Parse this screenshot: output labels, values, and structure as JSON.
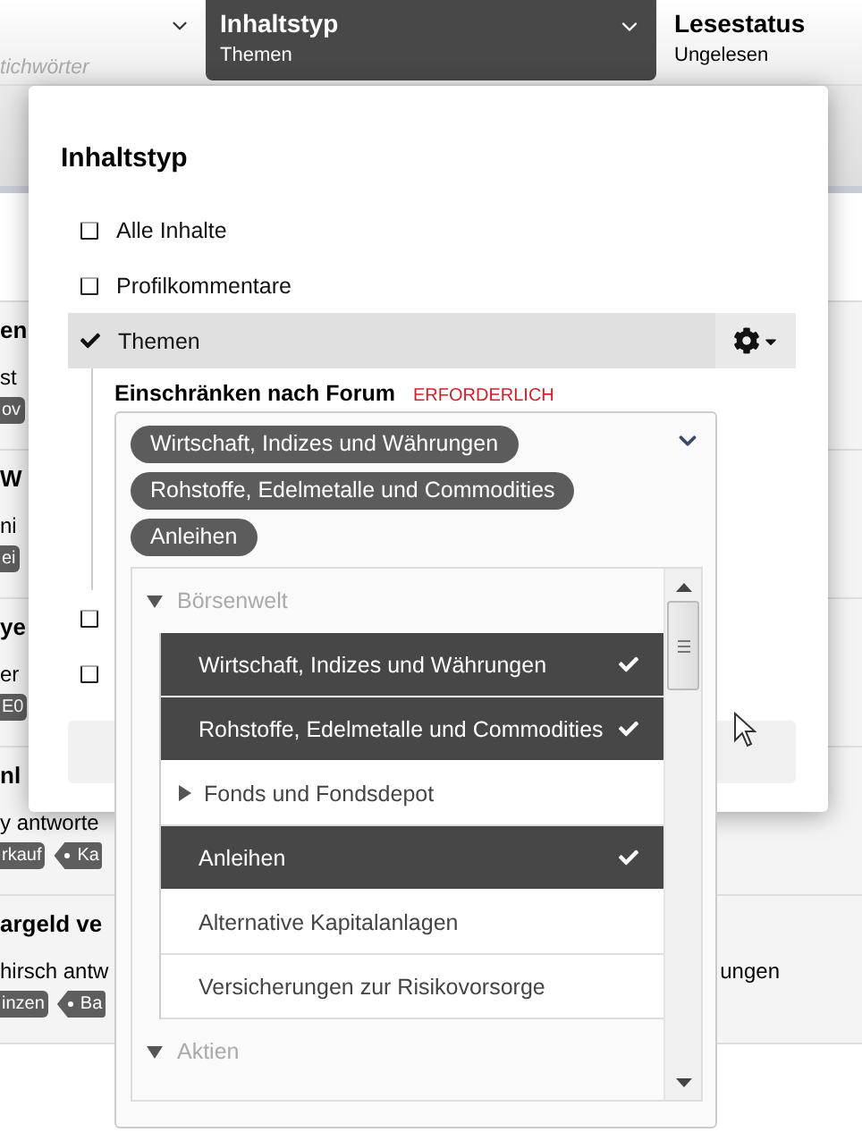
{
  "filters": [
    {
      "kind": "search",
      "placeholder": "tichwörter",
      "selected": false
    },
    {
      "kind": "menu",
      "label": "Inhaltstyp",
      "value": "Themen",
      "selected": true
    },
    {
      "kind": "menu",
      "label": "Lesestatus",
      "value": "Ungelesen",
      "selected": false
    }
  ],
  "threads": [
    {
      "title": "en",
      "excerpt": [
        "st"
      ],
      "tags": [
        {
          "kind": "plain",
          "label": "ov"
        }
      ]
    },
    {
      "title": "W",
      "excerpt": [
        "ni"
      ],
      "tags": [
        {
          "kind": "plain",
          "label": "ei"
        }
      ]
    },
    {
      "title": "ye",
      "excerpt": [
        "er"
      ],
      "tags": [
        {
          "kind": "plain",
          "label": "E0"
        }
      ]
    },
    {
      "title": "nl",
      "excerpt": [
        "y antworte"
      ],
      "tags": [
        {
          "kind": "plain",
          "label": "rkauf"
        },
        {
          "kind": "arrow",
          "label": "Ka"
        }
      ]
    },
    {
      "title": "argeld ve",
      "excerpt": [
        "hirsch antw",
        "ungen"
      ],
      "tags": [
        {
          "kind": "plain",
          "label": "inzen"
        },
        {
          "kind": "arrow",
          "label": "Ba"
        }
      ]
    }
  ],
  "popup": {
    "title": "Inhaltstyp",
    "options": [
      {
        "label": "Alle Inhalte",
        "checked": false
      },
      {
        "label": "Profilkommentare",
        "checked": false
      },
      {
        "label": "Themen",
        "checked": true,
        "forum_filter": {
          "label": "Einschränken nach Forum",
          "required": "ERFORDERLICH",
          "chips": [
            "Wirtschaft, Indizes und Währungen",
            "Rohstoffe, Edelmetalle und Commodities",
            "Anleihen"
          ],
          "tree": [
            {
              "label": "Börsenwelt",
              "expanded": true,
              "children": [
                {
                  "label": "Wirtschaft, Indizes und Währungen",
                  "selected": true
                },
                {
                  "label": "Rohstoffe, Edelmetalle und Commodities",
                  "selected": true
                },
                {
                  "label": "Fonds und Fondsdepot",
                  "selected": false,
                  "expanded": false
                },
                {
                  "label": "Anleihen",
                  "selected": true
                },
                {
                  "label": "Alternative Kapitalanlagen",
                  "selected": false
                },
                {
                  "label": "Versicherungen zur Risikovorsorge",
                  "selected": false
                }
              ]
            },
            {
              "label": "Aktien",
              "expanded": true
            }
          ]
        }
      },
      {
        "checked": false
      },
      {
        "checked": false
      }
    ]
  }
}
